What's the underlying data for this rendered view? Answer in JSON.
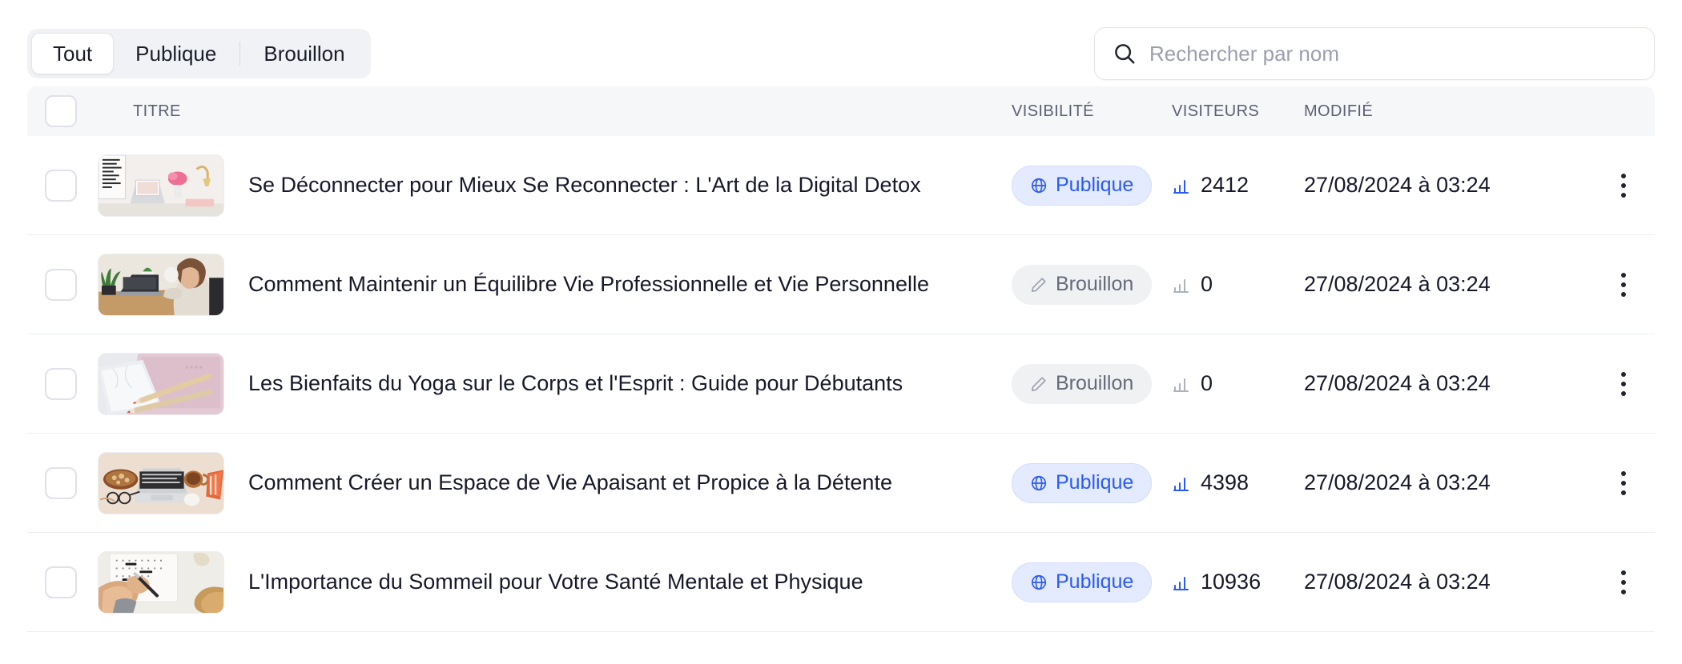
{
  "filters": {
    "items": [
      {
        "label": "Tout",
        "active": true
      },
      {
        "label": "Publique",
        "active": false
      },
      {
        "label": "Brouillon",
        "active": false
      }
    ]
  },
  "search": {
    "placeholder": "Rechercher par nom",
    "value": "",
    "icon": "search-icon"
  },
  "table": {
    "columns": {
      "title": "TITRE",
      "visibility": "VISIBILITÉ",
      "visitors": "VISITEURS",
      "modified": "MODIFIÉ"
    },
    "rows": [
      {
        "title": "Se Déconnecter pour Mieux Se Reconnecter : L'Art de la Digital Detox",
        "visibility": "Publique",
        "visibility_state": "public",
        "visitors": "2412",
        "modified": "27/08/2024 à 03:24",
        "thumbnail": "desk-flowers-laptop"
      },
      {
        "title": "Comment Maintenir un Équilibre Vie Professionnelle et Vie Personnelle",
        "visibility": "Brouillon",
        "visibility_state": "draft",
        "visitors": "0",
        "modified": "27/08/2024 à 03:24",
        "thumbnail": "woman-laptop-mug"
      },
      {
        "title": "Les Bienfaits du Yoga sur le Corps et l'Esprit : Guide pour Débutants",
        "visibility": "Brouillon",
        "visibility_state": "draft",
        "visitors": "0",
        "modified": "27/08/2024 à 03:24",
        "thumbnail": "notebooks-pencils"
      },
      {
        "title": "Comment Créer un Espace de Vie Apaisant et Propice à la Détente",
        "visibility": "Publique",
        "visibility_state": "public",
        "visitors": "4398",
        "modified": "27/08/2024 à 03:24",
        "thumbnail": "flatlay-laptop-coffee"
      },
      {
        "title": "L'Importance du Sommeil pour Votre Santé Mentale et Physique",
        "visibility": "Publique",
        "visibility_state": "public",
        "visitors": "10936",
        "modified": "27/08/2024 à 03:24",
        "thumbnail": "hands-writing-hat"
      }
    ]
  },
  "icons": {
    "visibility_public": "globe-icon",
    "visibility_draft": "pencil-icon",
    "visitors": "bar-chart-icon",
    "row_menu": "kebab-menu-icon",
    "checkbox": "checkbox-icon"
  },
  "colors": {
    "public_text": "#2a5bf5",
    "public_bg": "#e4eaff",
    "draft_text": "#646a78",
    "draft_bg": "#f0f1f3",
    "header_bg": "#f6f7f9",
    "text": "#17192a"
  }
}
